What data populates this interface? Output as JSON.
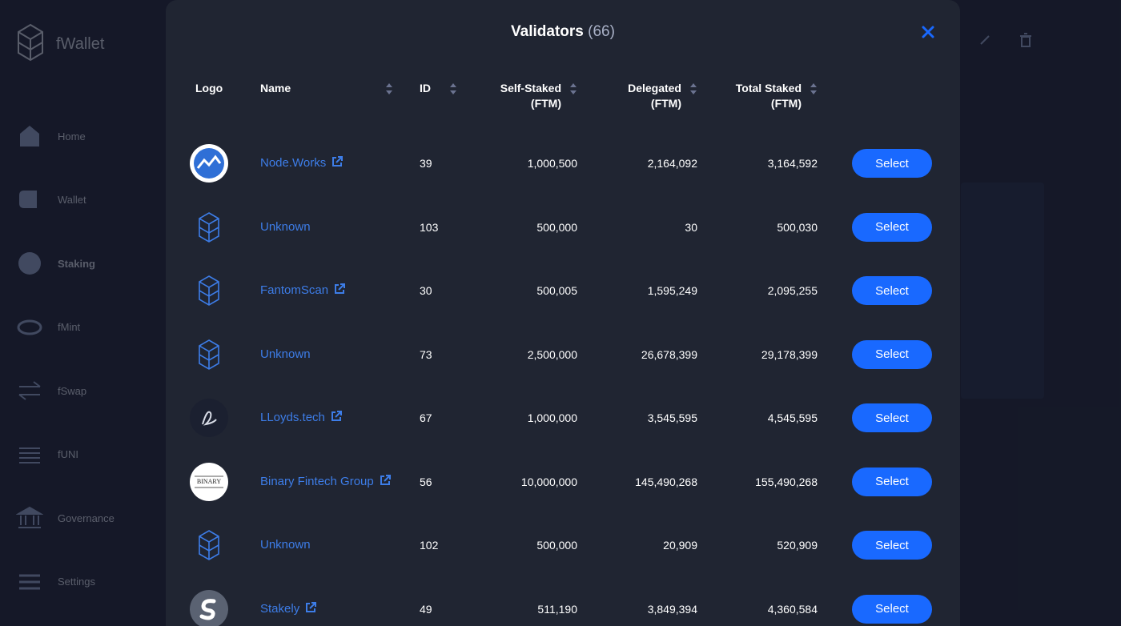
{
  "app": {
    "brand": "fWallet",
    "nav": [
      {
        "label": "Home",
        "icon": "home-icon"
      },
      {
        "label": "Wallet",
        "icon": "wallet-icon"
      },
      {
        "label": "Staking",
        "icon": "staking-icon"
      },
      {
        "label": "fMint",
        "icon": "fmint-icon"
      },
      {
        "label": "fSwap",
        "icon": "fswap-icon"
      },
      {
        "label": "fUNI",
        "icon": "funi-icon"
      },
      {
        "label": "Governance",
        "icon": "governance-icon"
      },
      {
        "label": "Settings",
        "icon": "settings-icon"
      }
    ],
    "active_nav": "Staking"
  },
  "modal": {
    "title": "Validators",
    "count": "(66)",
    "columns": {
      "logo": "Logo",
      "name": "Name",
      "id": "ID",
      "self_staked": "Self-Staked",
      "self_staked_unit": "(FTM)",
      "delegated": "Delegated",
      "delegated_unit": "(FTM)",
      "total_staked": "Total Staked",
      "total_staked_unit": "(FTM)"
    },
    "select_label": "Select",
    "rows": [
      {
        "name": "Node.Works",
        "external_link": true,
        "logo": "nodeworks-logo",
        "id": "39",
        "self_staked": "1,000,500",
        "delegated": "2,164,092",
        "total_staked": "3,164,592"
      },
      {
        "name": "Unknown",
        "external_link": false,
        "logo": "fantom-logo",
        "id": "103",
        "self_staked": "500,000",
        "delegated": "30",
        "total_staked": "500,030"
      },
      {
        "name": "FantomScan",
        "external_link": true,
        "logo": "fantom-logo",
        "id": "30",
        "self_staked": "500,005",
        "delegated": "1,595,249",
        "total_staked": "2,095,255"
      },
      {
        "name": "Unknown",
        "external_link": false,
        "logo": "fantom-logo",
        "id": "73",
        "self_staked": "2,500,000",
        "delegated": "26,678,399",
        "total_staked": "29,178,399"
      },
      {
        "name": "LLoyds.tech",
        "external_link": true,
        "logo": "lloyds-logo",
        "id": "67",
        "self_staked": "1,000,000",
        "delegated": "3,545,595",
        "total_staked": "4,545,595"
      },
      {
        "name": "Binary Fintech Group",
        "external_link": true,
        "logo": "binary-logo",
        "logo_text": "BINARY",
        "id": "56",
        "self_staked": "10,000,000",
        "delegated": "145,490,268",
        "total_staked": "155,490,268"
      },
      {
        "name": "Unknown",
        "external_link": false,
        "logo": "fantom-logo",
        "id": "102",
        "self_staked": "500,000",
        "delegated": "20,909",
        "total_staked": "520,909"
      },
      {
        "name": "Stakely",
        "external_link": true,
        "logo": "stakely-logo",
        "id": "49",
        "self_staked": "511,190",
        "delegated": "3,849,394",
        "total_staked": "4,360,584"
      }
    ]
  },
  "colors": {
    "accent": "#1969ff",
    "link": "#3d7de8",
    "modal_bg": "#202532"
  }
}
